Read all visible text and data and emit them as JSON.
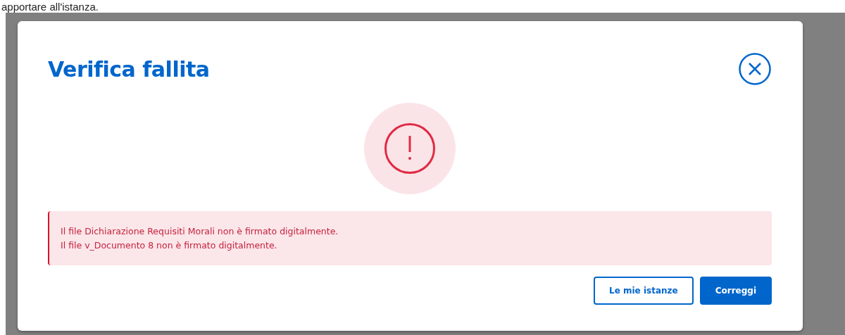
{
  "page_text": "apportare all'istanza.",
  "dialog": {
    "title": "Verifica fallita",
    "messages": [
      "Il file Dichiarazione Requisiti Morali non è firmato digitalmente.",
      "Il file v_Documento 8 non è firmato digitalmente."
    ],
    "buttons": [
      {
        "label": "Le mie istanze",
        "kind": "secondary"
      },
      {
        "label": "Correggi",
        "kind": "primary"
      }
    ]
  }
}
